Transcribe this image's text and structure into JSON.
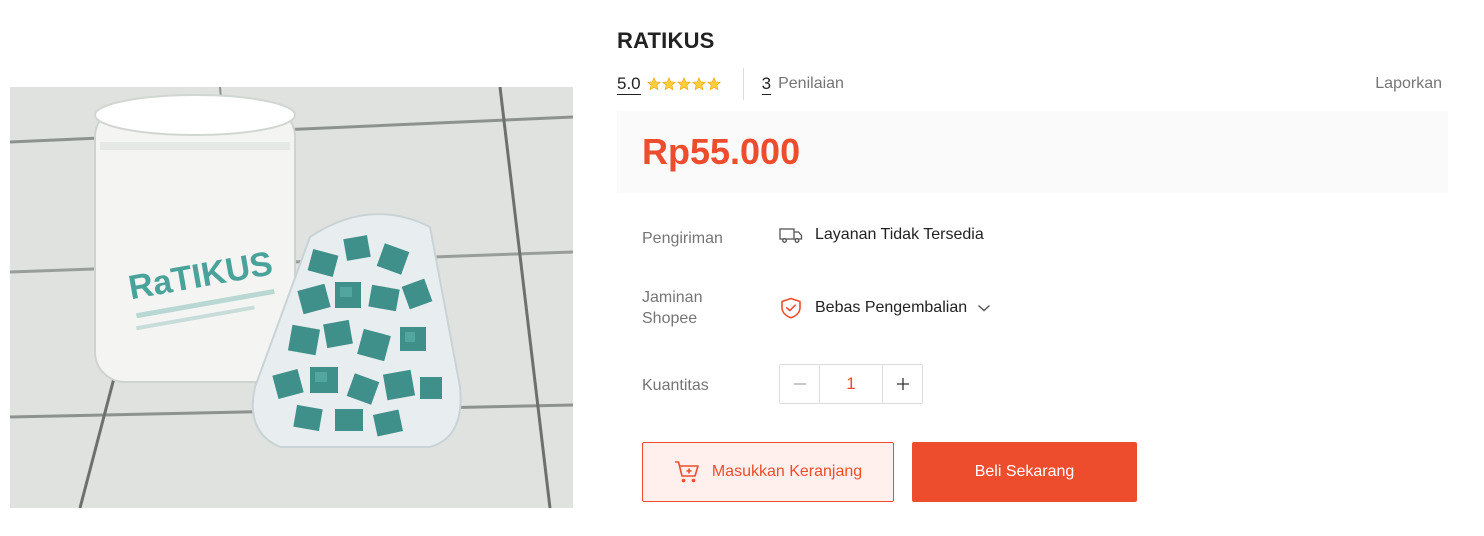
{
  "product": {
    "title": "RATIKUS",
    "image_label": "RaTIKUS",
    "rating": "5.0",
    "rating_stars": 5,
    "review_count": "3",
    "review_label": "Penilaian",
    "report_label": "Laporkan",
    "price": "Rp55.000"
  },
  "shipping": {
    "label": "Pengiriman",
    "value": "Layanan Tidak Tersedia",
    "icon": "truck-icon"
  },
  "guarantee": {
    "label_line1": "Jaminan",
    "label_line2": "Shopee",
    "value": "Bebas Pengembalian",
    "icon": "shield-check-icon"
  },
  "quantity": {
    "label": "Kuantitas",
    "value": "1"
  },
  "actions": {
    "add_to_cart": "Masukkan Keranjang",
    "buy_now": "Beli Sekarang"
  },
  "colors": {
    "accent": "#ee4d2d",
    "star": "#ffce3d",
    "cart_bg": "#fff0ed",
    "price_bg": "#fafafa",
    "muted": "#757575"
  }
}
